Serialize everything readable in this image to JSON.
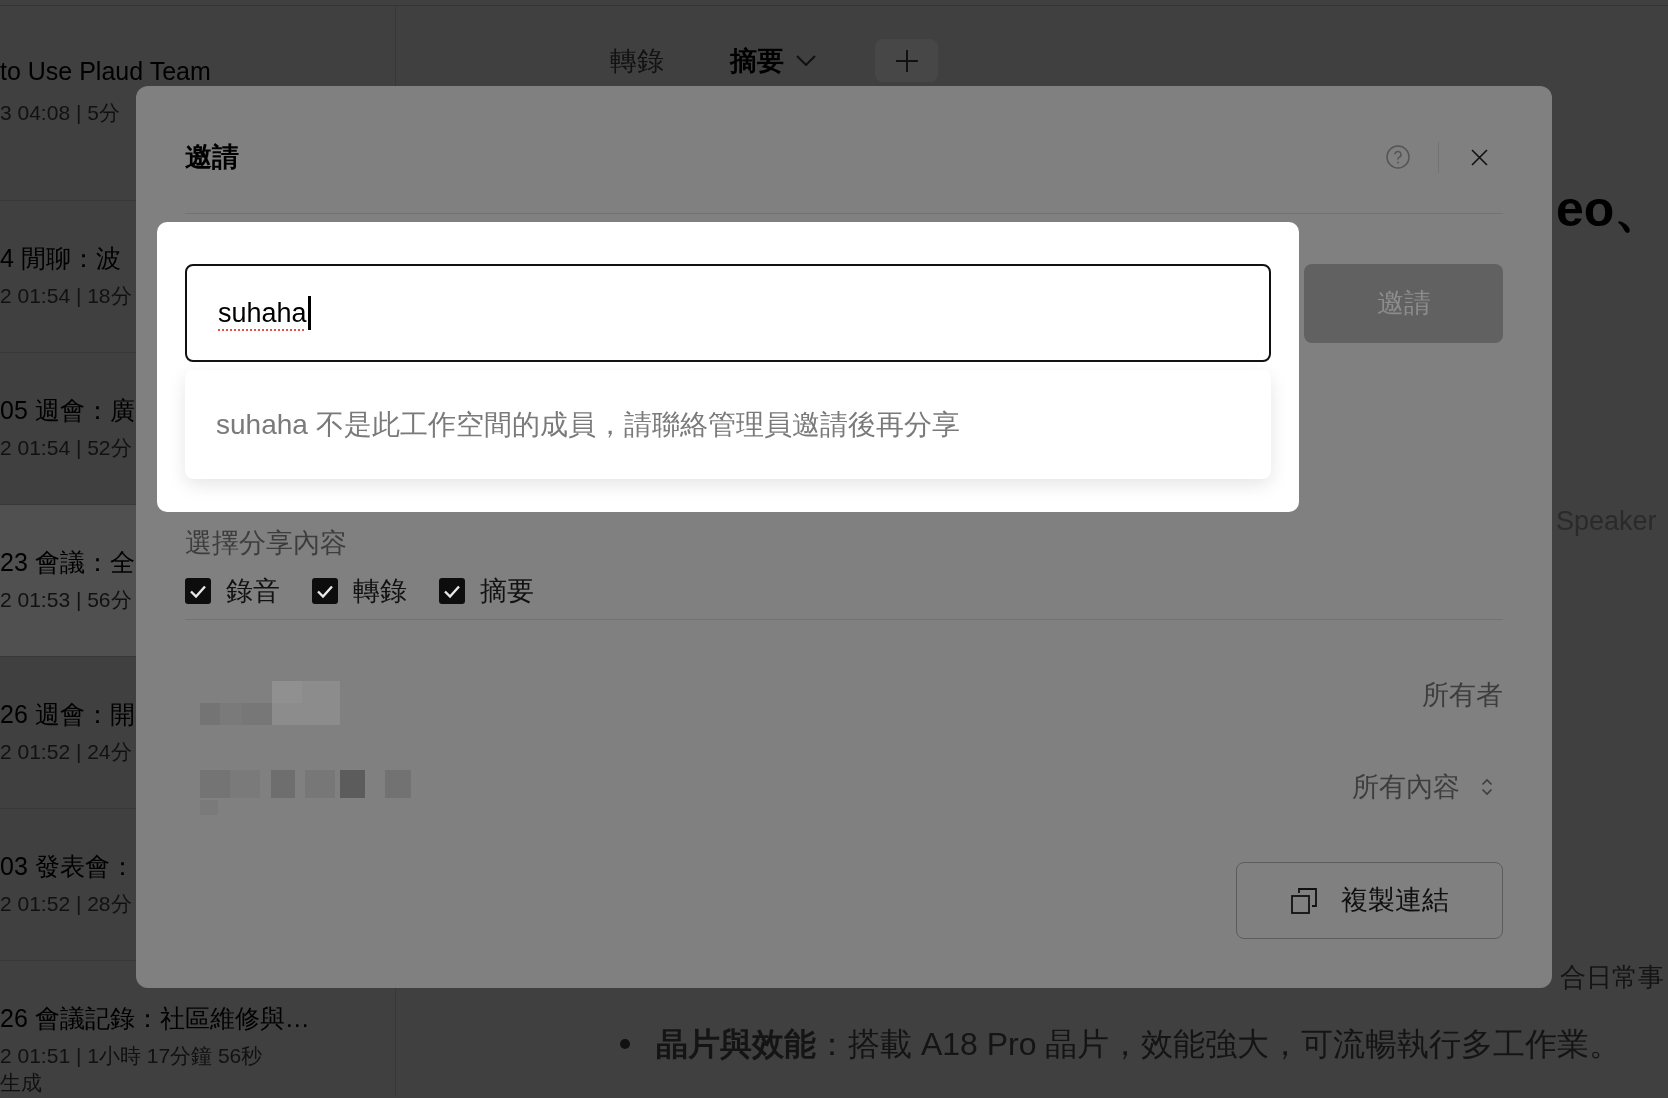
{
  "sidebar": {
    "items": [
      {
        "title": "to Use Plaud Team",
        "meta": "3 04:08 | 5分",
        "selected": false
      },
      {
        "title": "4 閒聊：波",
        "meta": "2 01:54 | 18分",
        "selected": false
      },
      {
        "title": "05 週會：廣",
        "meta": "2 01:54 | 52分",
        "selected": false
      },
      {
        "title": "23 會議：全",
        "meta": "2 01:53 | 56分",
        "selected": true
      },
      {
        "title": "26 週會：開",
        "meta": "2 01:52 | 24分",
        "selected": false
      },
      {
        "title": "03 發表會：",
        "meta": "2 01:52 | 28分",
        "selected": false
      },
      {
        "title": "26 會議記錄：社區維修與…",
        "meta": "2 01:51 | 1小時 17分鐘 56秒",
        "status": "生成",
        "selected": false
      }
    ]
  },
  "tabs": [
    {
      "label": "轉錄",
      "selected": false,
      "dropdown": false
    },
    {
      "label": "摘要",
      "selected": true,
      "dropdown": true
    }
  ],
  "document": {
    "heading": "eo、",
    "speaker": "Speaker",
    "paragraph": "合日常事",
    "bullets": [
      "**晶片與效能**：搭載 A18 Pro 晶片，效能強大，可流暢執行多工作業。"
    ]
  },
  "dialog": {
    "title": "邀請",
    "invite_field": {
      "value": "suhaha",
      "focused": true
    },
    "invite_button": {
      "label": "邀請",
      "disabled": true
    },
    "suggestion": "suhaha 不是此工作空間的成員，請聯絡管理員邀請後再分享",
    "share": {
      "label": "選擇分享內容",
      "options": [
        {
          "label": "錄音",
          "checked": true
        },
        {
          "label": "轉錄",
          "checked": true
        },
        {
          "label": "摘要",
          "checked": true
        }
      ]
    },
    "owner_role": "所有者",
    "link_access": "所有內容",
    "copy_link_button": "複製連結"
  }
}
